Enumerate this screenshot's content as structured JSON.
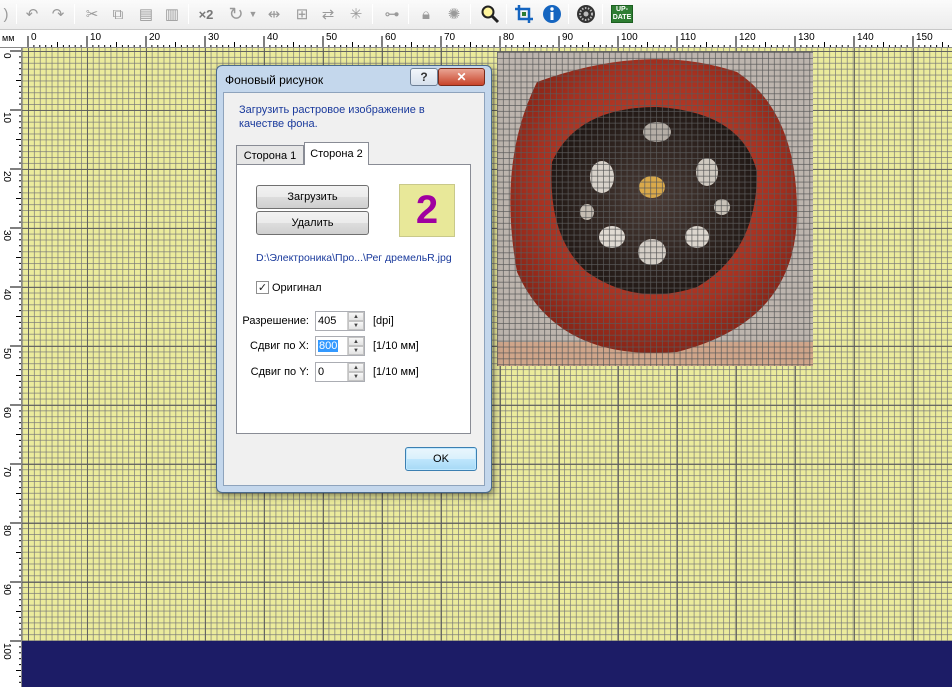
{
  "toolbar": {
    "icons": [
      "undo-icon",
      "redo-icon",
      "cut-icon",
      "copy-icon",
      "paste-icon",
      "delete-icon",
      "scale-icon",
      "rotate-icon",
      "dropdown-arrow-icon",
      "mirror-icon",
      "component-icon",
      "swap-icon",
      "autoroute-icon",
      "connection-icon",
      "lock-icon",
      "bug-icon",
      "zoom-icon",
      "crop-icon",
      "info-icon",
      "texture-icon",
      "update-icon"
    ],
    "x2_label": "×2",
    "update_label_1": "UP-",
    "update_label_2": "DATE"
  },
  "ruler": {
    "unit": "мм",
    "top_labels": [
      "0",
      "10",
      "20",
      "30",
      "40",
      "50",
      "60",
      "70",
      "80",
      "90",
      "100",
      "110",
      "120",
      "130",
      "140",
      "150"
    ],
    "left_labels": [
      "0",
      "10",
      "20",
      "30",
      "40",
      "50",
      "60",
      "70",
      "80",
      "90",
      "100"
    ]
  },
  "dialog": {
    "title": "Фоновый рисунок",
    "help_label": "?",
    "close_label": "✕",
    "description": "Загрузить растровое изображение в качестве фона.",
    "tabs": [
      {
        "label": "Сторона 1",
        "active": false
      },
      {
        "label": "Сторона 2",
        "active": true
      }
    ],
    "load_button": "Загрузить",
    "delete_button": "Удалить",
    "side_number": "2",
    "file_path": "D:\\Электроника\\Про...\\Рег дремельR.jpg",
    "original_checkbox": {
      "label": "Оригинал",
      "checked": true
    },
    "resolution": {
      "label": "Разрешение:",
      "value": "405",
      "unit": "[dpi]"
    },
    "shift_x": {
      "label": "Сдвиг по X:",
      "value": "800",
      "unit": "[1/10 мм]"
    },
    "shift_y": {
      "label": "Сдвиг по Y:",
      "value": "0",
      "unit": "[1/10 мм]"
    },
    "ok_button": "OK"
  },
  "colors": {
    "grid_background": "#ebeb9c",
    "board_edge": "#1c1c66",
    "side_number_color": "#a000a0"
  }
}
